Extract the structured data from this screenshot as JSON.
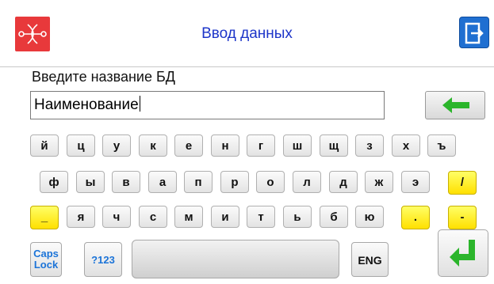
{
  "header": {
    "title": "Ввод данных",
    "logo_icon": "logo-knot-icon",
    "exit_icon": "exit-door-icon"
  },
  "form": {
    "prompt": "Введите название БД",
    "input_value": "Наименование"
  },
  "keyboard": {
    "row1": [
      "й",
      "ц",
      "у",
      "к",
      "е",
      "н",
      "г",
      "ш",
      "щ",
      "з",
      "х",
      "ъ"
    ],
    "row2": [
      "ф",
      "ы",
      "в",
      "а",
      "п",
      "р",
      "о",
      "л",
      "д",
      "ж",
      "э",
      "/"
    ],
    "row3": [
      "_",
      "я",
      "ч",
      "с",
      "м",
      "и",
      "т",
      "ь",
      "б",
      "ю",
      ".",
      "-"
    ],
    "caps": "Caps Lock",
    "caps_line1": "Caps",
    "caps_line2": "Lock",
    "num": "?123",
    "space": "",
    "lang": "ENG"
  },
  "colors": {
    "accent_red": "#e8393b",
    "title_blue": "#1d35c9",
    "exit_blue": "#1f6fd1",
    "green_arrow": "#2bb52b",
    "yellow_key": "#ffe000"
  }
}
